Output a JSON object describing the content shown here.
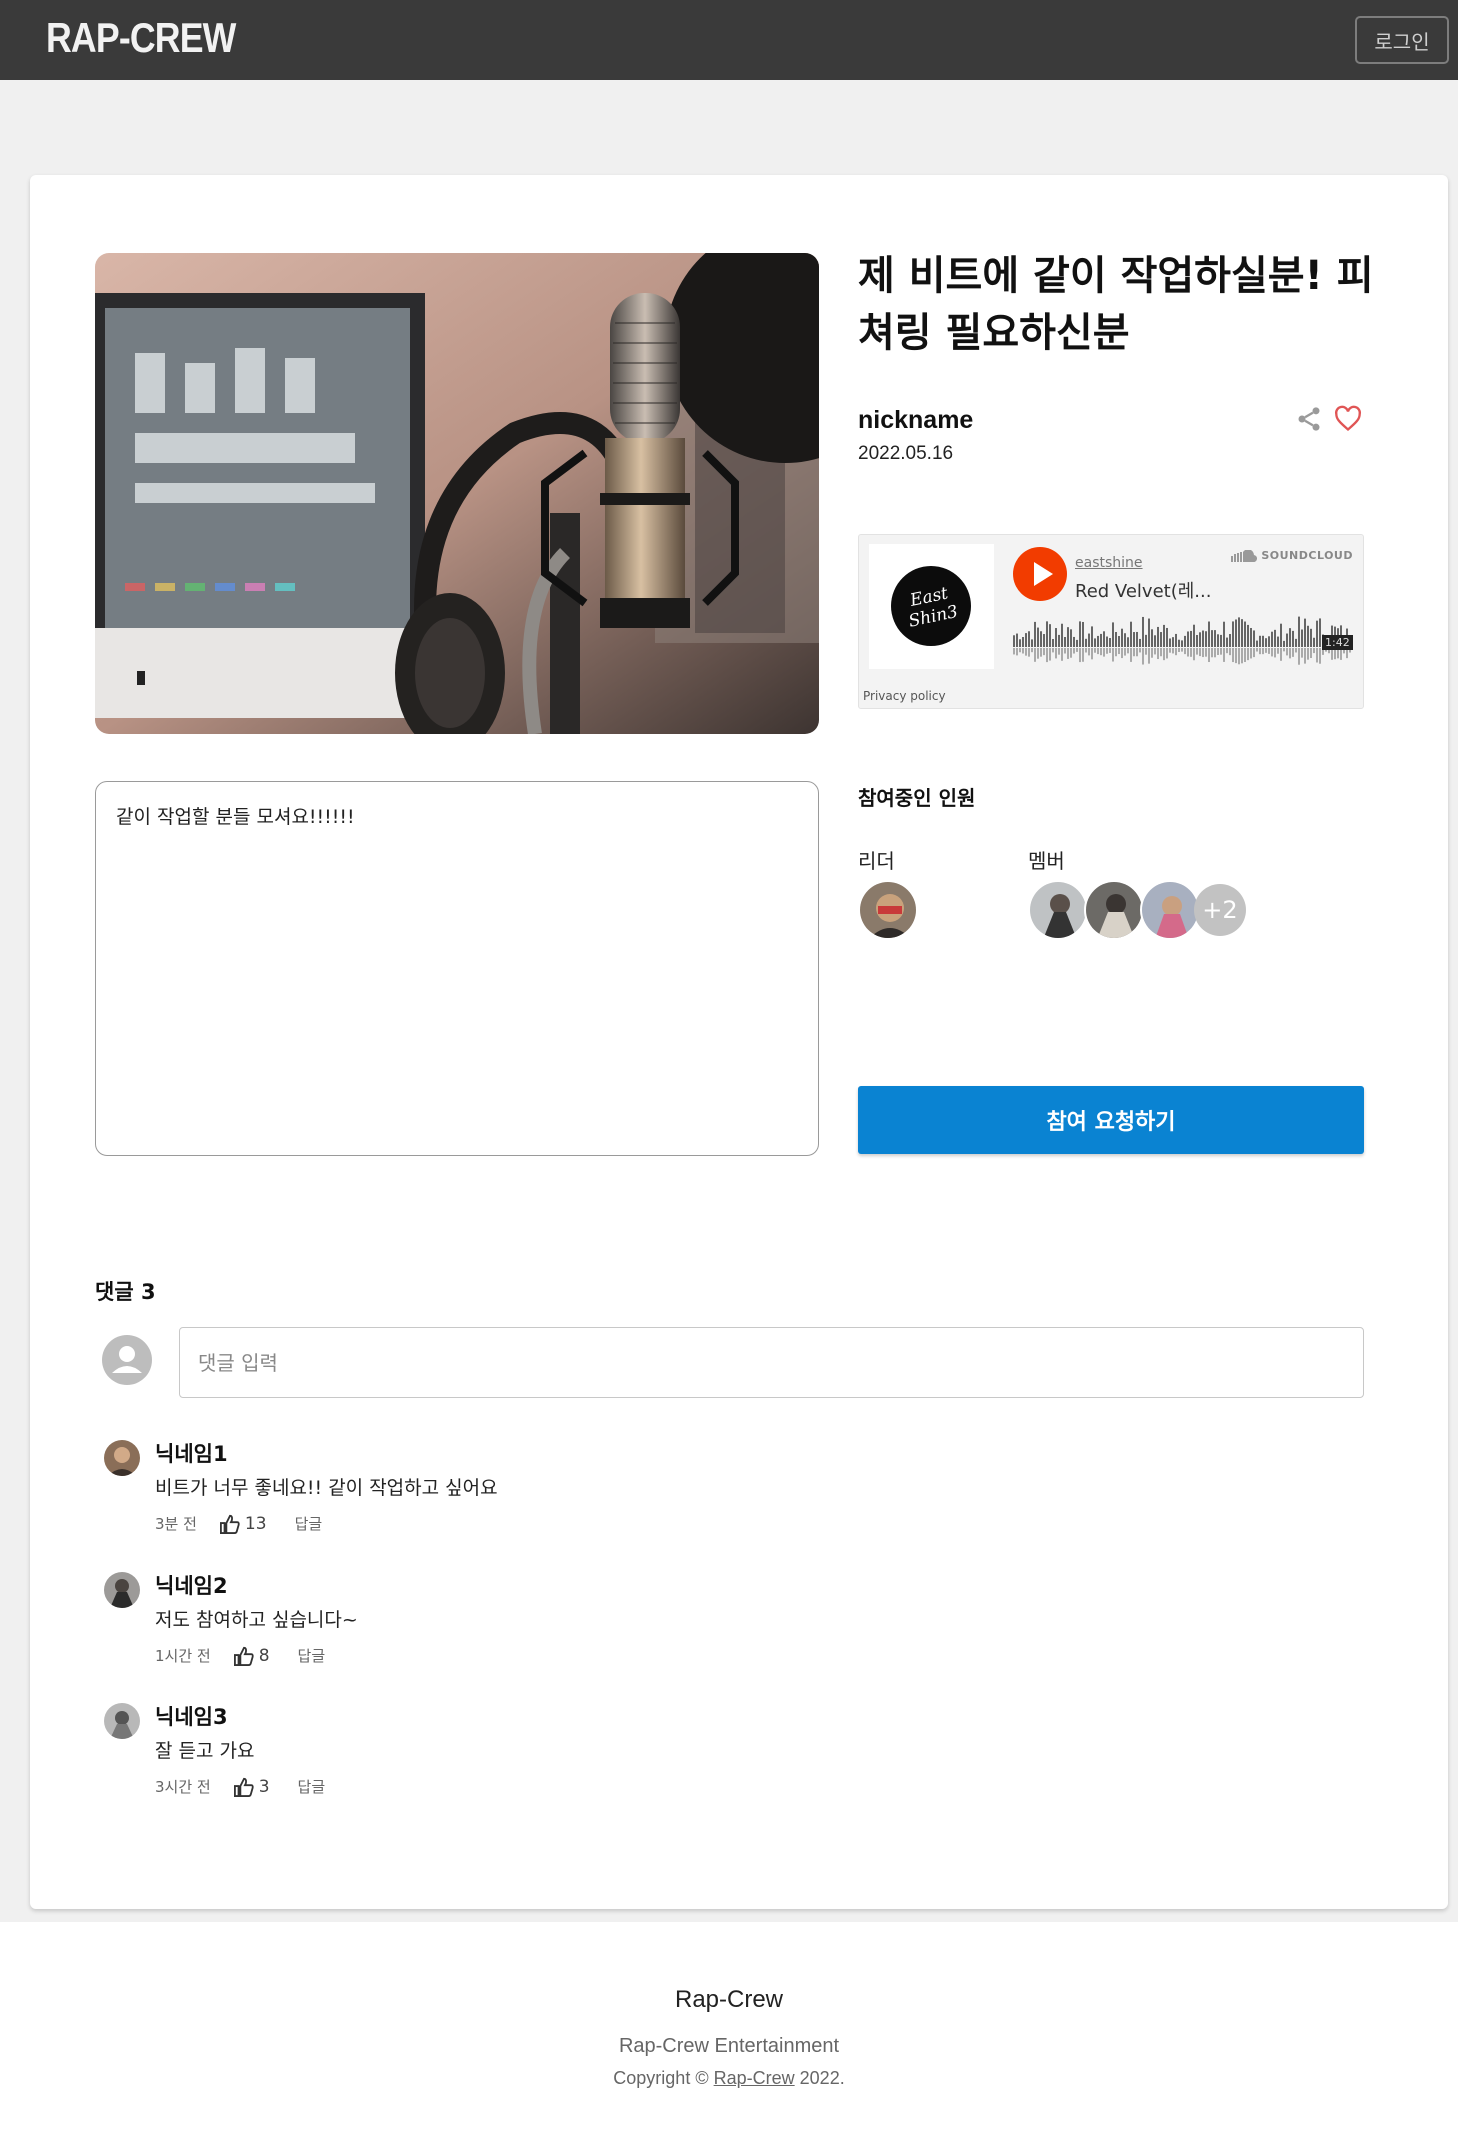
{
  "header": {
    "logo": "RAP-CREW",
    "login_label": "로그인"
  },
  "post": {
    "title": "제 비트에 같이 작업하실분! 피쳐링 필요하신분",
    "author": "nickname",
    "date": "2022.05.16",
    "description": "같이 작업할 분들 모셔요!!!!!!"
  },
  "soundcloud": {
    "user": "eastshine",
    "track": "Red Velvet(레...",
    "brand": "SOUNDCLOUD",
    "duration": "1:42",
    "privacy": "Privacy policy",
    "art_text": "East Shin3"
  },
  "members": {
    "title": "참여중인 인원",
    "leader_label": "리더",
    "member_label": "멤버",
    "extra_count": "+2"
  },
  "join_button": "참여 요청하기",
  "comments": {
    "title_prefix": "댓글",
    "count": "3",
    "input_placeholder": "댓글 입력",
    "items": [
      {
        "name": "닉네임1",
        "text": "비트가 너무 좋네요!! 같이 작업하고 싶어요",
        "time": "3분 전",
        "likes": "13",
        "reply": "답글"
      },
      {
        "name": "닉네임2",
        "text": "저도 참여하고 싶습니다~",
        "time": "1시간 전",
        "likes": "8",
        "reply": "답글"
      },
      {
        "name": "닉네임3",
        "text": "잘 듣고 가요",
        "time": "3시간 전",
        "likes": "3",
        "reply": "답글"
      }
    ]
  },
  "footer": {
    "title": "Rap-Crew",
    "company": "Rap-Crew Entertainment",
    "copyright_prefix": "Copyright ©",
    "copyright_link": "Rap-Crew",
    "copyright_year": "2022."
  },
  "colors": {
    "accent": "#0a83d2",
    "topbar": "#3a3a3a",
    "heart": "#e05555",
    "soundcloud": "#f23c00"
  }
}
